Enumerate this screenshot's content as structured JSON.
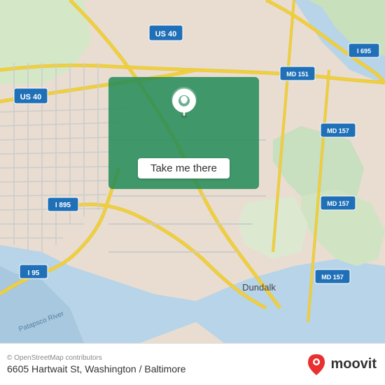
{
  "map": {
    "background_color": "#e8e0d8",
    "highlight_box": {
      "button_label": "Take me there"
    },
    "road_labels": {
      "us40_top": "US 40",
      "us40_left": "US 40",
      "i895": "I 895",
      "i95": "I 95",
      "md151": "MD 151",
      "md157_top": "MD 157",
      "md157_mid": "MD 157",
      "md157_bot": "MD 157",
      "i695": "I 695",
      "dundalk": "Dundalk",
      "patapsco_river": "Patapsco River"
    }
  },
  "footer": {
    "osm_credit": "© OpenStreetMap contributors",
    "address": "6605 Hartwait St, Washington / Baltimore",
    "moovit_label": "moovit"
  }
}
